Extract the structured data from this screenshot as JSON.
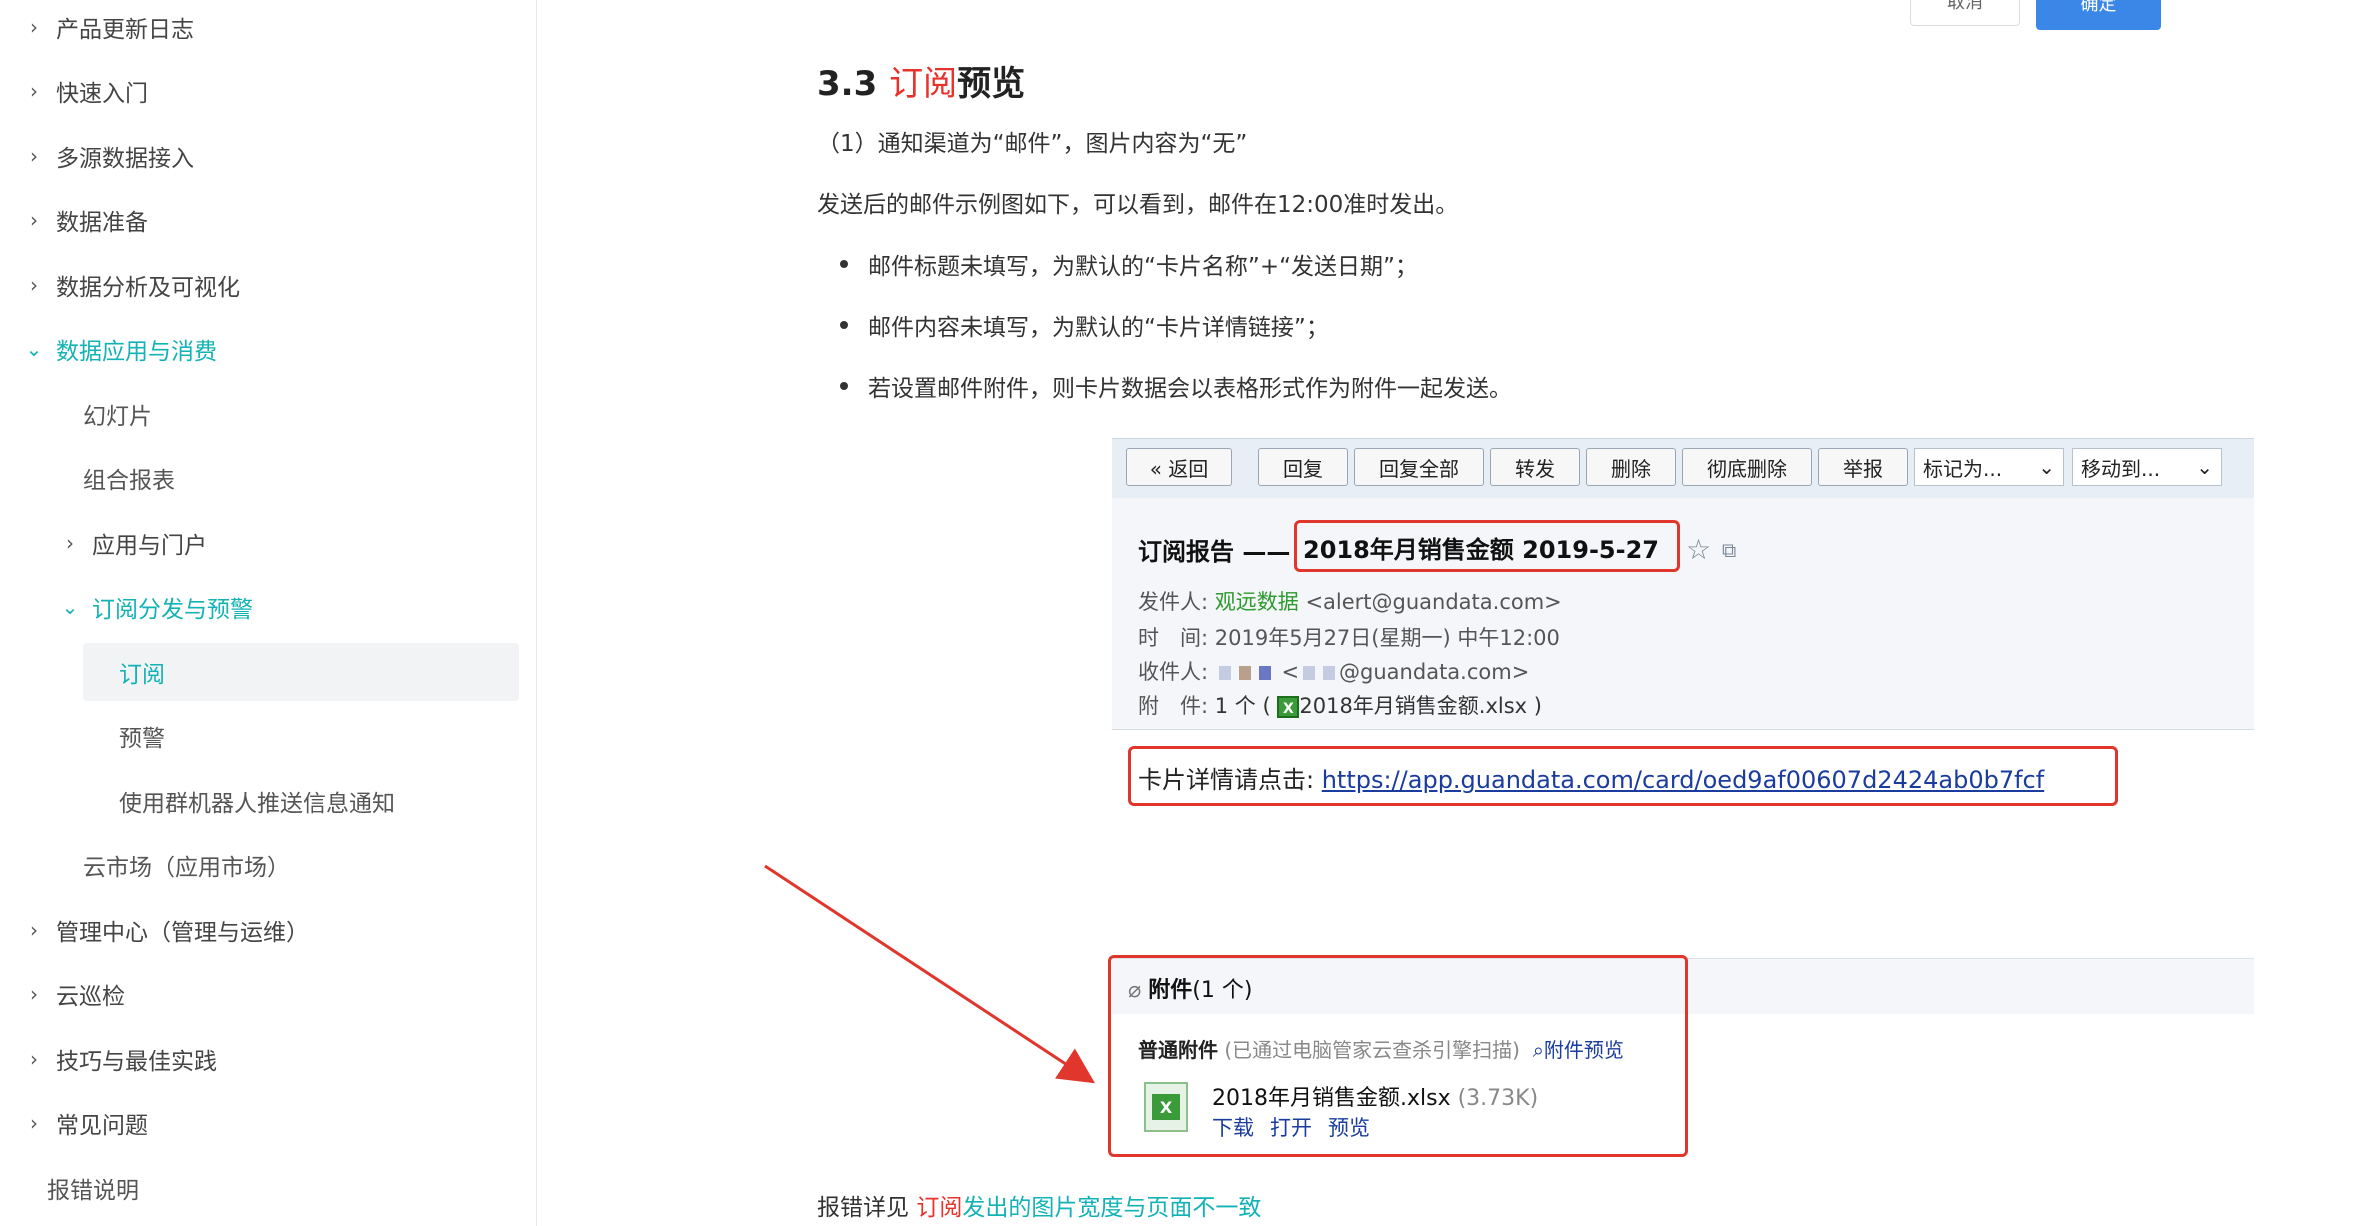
{
  "sidebar": {
    "items": [
      {
        "label": "产品更新日志"
      },
      {
        "label": "快速入门"
      },
      {
        "label": "多源数据接入"
      },
      {
        "label": "数据准备"
      },
      {
        "label": "数据分析及可视化"
      },
      {
        "label": "数据应用与消费"
      },
      {
        "label": "幻灯片"
      },
      {
        "label": "组合报表"
      },
      {
        "label": "应用与门户"
      },
      {
        "label": "订阅分发与预警"
      },
      {
        "label": "订阅"
      },
      {
        "label": "预警"
      },
      {
        "label": "使用群机器人推送信息通知"
      },
      {
        "label": "云市场（应用市场）"
      },
      {
        "label": "管理中心（管理与运维）"
      },
      {
        "label": "云巡检"
      },
      {
        "label": "技巧与最佳实践"
      },
      {
        "label": "常见问题"
      },
      {
        "label": "报错说明"
      }
    ]
  },
  "top_buttons": {
    "cancel": "取消",
    "ok": "确定"
  },
  "content": {
    "heading_num": "3.3 ",
    "heading_red": "订阅",
    "heading_rest": "预览",
    "item1": "（1）通知渠道为“邮件”，图片内容为“无”",
    "desc": "发送后的邮件示例图如下，可以看到，邮件在12:00准时发出。",
    "bullets": [
      "邮件标题未填写，为默认的“卡片名称”+“发送日期”；",
      "邮件内容未填写，为默认的“卡片详情链接”；",
      "若设置邮件附件，则卡片数据会以表格形式作为附件一起发送。"
    ],
    "footer_prefix": "报错详见 ",
    "footer_red": "订阅",
    "footer_teal": "发出的图片宽度与页面不一致"
  },
  "email": {
    "toolbar": [
      "« 返回",
      "回复",
      "回复全部",
      "转发",
      "删除",
      "彻底删除",
      "举报"
    ],
    "mark_as": "标记为...",
    "move_to": "移动到...",
    "title_prefix": "订阅报告 ——",
    "subject": "2018年月销售金额 2019-5-27",
    "sender_label": "发件人: ",
    "sender_name": "观远数据",
    "sender_email": " <alert@guandata.com>",
    "time_label": "时　间: ",
    "time_value": "2019年5月27日(星期一) 中午12:00",
    "recipient_label": "收件人: ",
    "recipient_email": "@guandata.com>",
    "attach_label": "附　件: ",
    "attach_count": "1 个 ( ",
    "attach_file": "2018年月销售金额.xlsx",
    "attach_close": " )",
    "card_label": "卡片详情请点击: ",
    "card_url": "https://app.guandata.com/card/oed9af00607d2424ab0b7fcf",
    "attach_section_title": "附件",
    "attach_section_count": "(1 个)",
    "normal_attach": "普通附件",
    "scan_note": " (已通过电脑管家云查杀引擎扫描)",
    "preview_link": "附件预览",
    "file_name": "2018年月销售金额.xlsx",
    "file_size": " (3.73K)",
    "file_actions": [
      "下载",
      "打开",
      "预览"
    ]
  },
  "colors": {
    "accent": "#13b2b5",
    "red": "#e8322b",
    "primary": "#3a87e8"
  }
}
